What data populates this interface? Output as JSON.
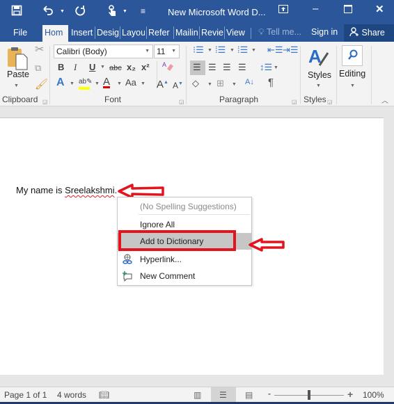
{
  "titlebar": {
    "title": "New Microsoft Word D...",
    "save_icon": "save-icon",
    "undo_icon": "undo-icon",
    "redo_icon": "redo-icon",
    "touch_icon": "touch-mode-icon",
    "customize_icon": "customize-qat-icon",
    "ribbon_display_icon": "ribbon-display-options-icon",
    "minimize_icon": "minimize-icon",
    "maximize_icon": "maximize-icon",
    "close_icon": "close-icon"
  },
  "tabs": [
    {
      "label": "File"
    },
    {
      "label": "Hom",
      "active": true
    },
    {
      "label": "Insert"
    },
    {
      "label": "Desig"
    },
    {
      "label": "Layou"
    },
    {
      "label": "Refer"
    },
    {
      "label": "Mailin"
    },
    {
      "label": "Revie"
    },
    {
      "label": "View"
    }
  ],
  "tell_me": "Tell me...",
  "sign_in": "Sign in",
  "share": "Share",
  "ribbon": {
    "clipboard": {
      "label": "Clipboard",
      "paste": "Paste"
    },
    "font": {
      "label": "Font",
      "font_name": "Calibri (Body)",
      "font_size": "11",
      "bold": "B",
      "italic": "I",
      "underline": "U",
      "strikethrough": "abc",
      "subscript": "x₂",
      "superscript": "x²",
      "change_case": "Aa",
      "grow": "A",
      "shrink": "A",
      "highlight_color": "#ffff00",
      "font_color": "#e00000"
    },
    "paragraph": {
      "label": "Paragraph",
      "sort": "A↓",
      "pilcrow": "¶"
    },
    "styles": {
      "label": "Styles",
      "button": "Styles"
    },
    "editing": {
      "button": "Editing"
    }
  },
  "document": {
    "text_before": "My name is ",
    "misspelled_word": "Sreelakshmi",
    "text_after": "."
  },
  "context_menu": {
    "items": [
      {
        "label": "(No Spelling Suggestions)",
        "disabled": true
      },
      {
        "label": "Ignore All"
      },
      {
        "label": "Add to Dictionary",
        "highlighted": true
      },
      {
        "label": "Hyperlink...",
        "icon": "hyperlink-icon"
      },
      {
        "label": "New Comment",
        "icon": "new-comment-icon"
      }
    ]
  },
  "annotations": {
    "color": "#e3141e"
  },
  "statusbar": {
    "page": "Page 1 of 1",
    "words": "4 words",
    "zoom_label": "100%",
    "zoom_minus": "-",
    "zoom_plus": "+"
  }
}
